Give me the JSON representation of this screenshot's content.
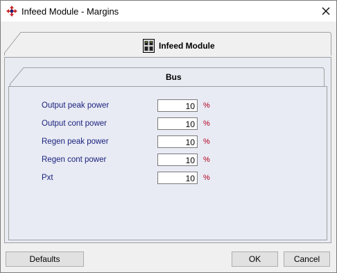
{
  "window": {
    "title": "Infeed Module - Margins",
    "app_icon": "move-cross-icon",
    "close_icon": "close-icon"
  },
  "outer_tab": {
    "label": "Infeed Module",
    "icon": "module-icon"
  },
  "inner_tab": {
    "label": "Bus"
  },
  "rows": [
    {
      "label": "Output peak power",
      "value": "10",
      "unit": "%"
    },
    {
      "label": "Output cont power",
      "value": "10",
      "unit": "%"
    },
    {
      "label": "Regen peak power",
      "value": "10",
      "unit": "%"
    },
    {
      "label": "Regen cont power",
      "value": "10",
      "unit": "%"
    },
    {
      "label": "Pxt",
      "value": "10",
      "unit": "%"
    }
  ],
  "buttons": {
    "defaults": "Defaults",
    "ok": "OK",
    "cancel": "Cancel"
  },
  "colors": {
    "label_text": "#1a237e",
    "unit_text": "#b00020",
    "panel_bg": "#e9ebf3"
  }
}
